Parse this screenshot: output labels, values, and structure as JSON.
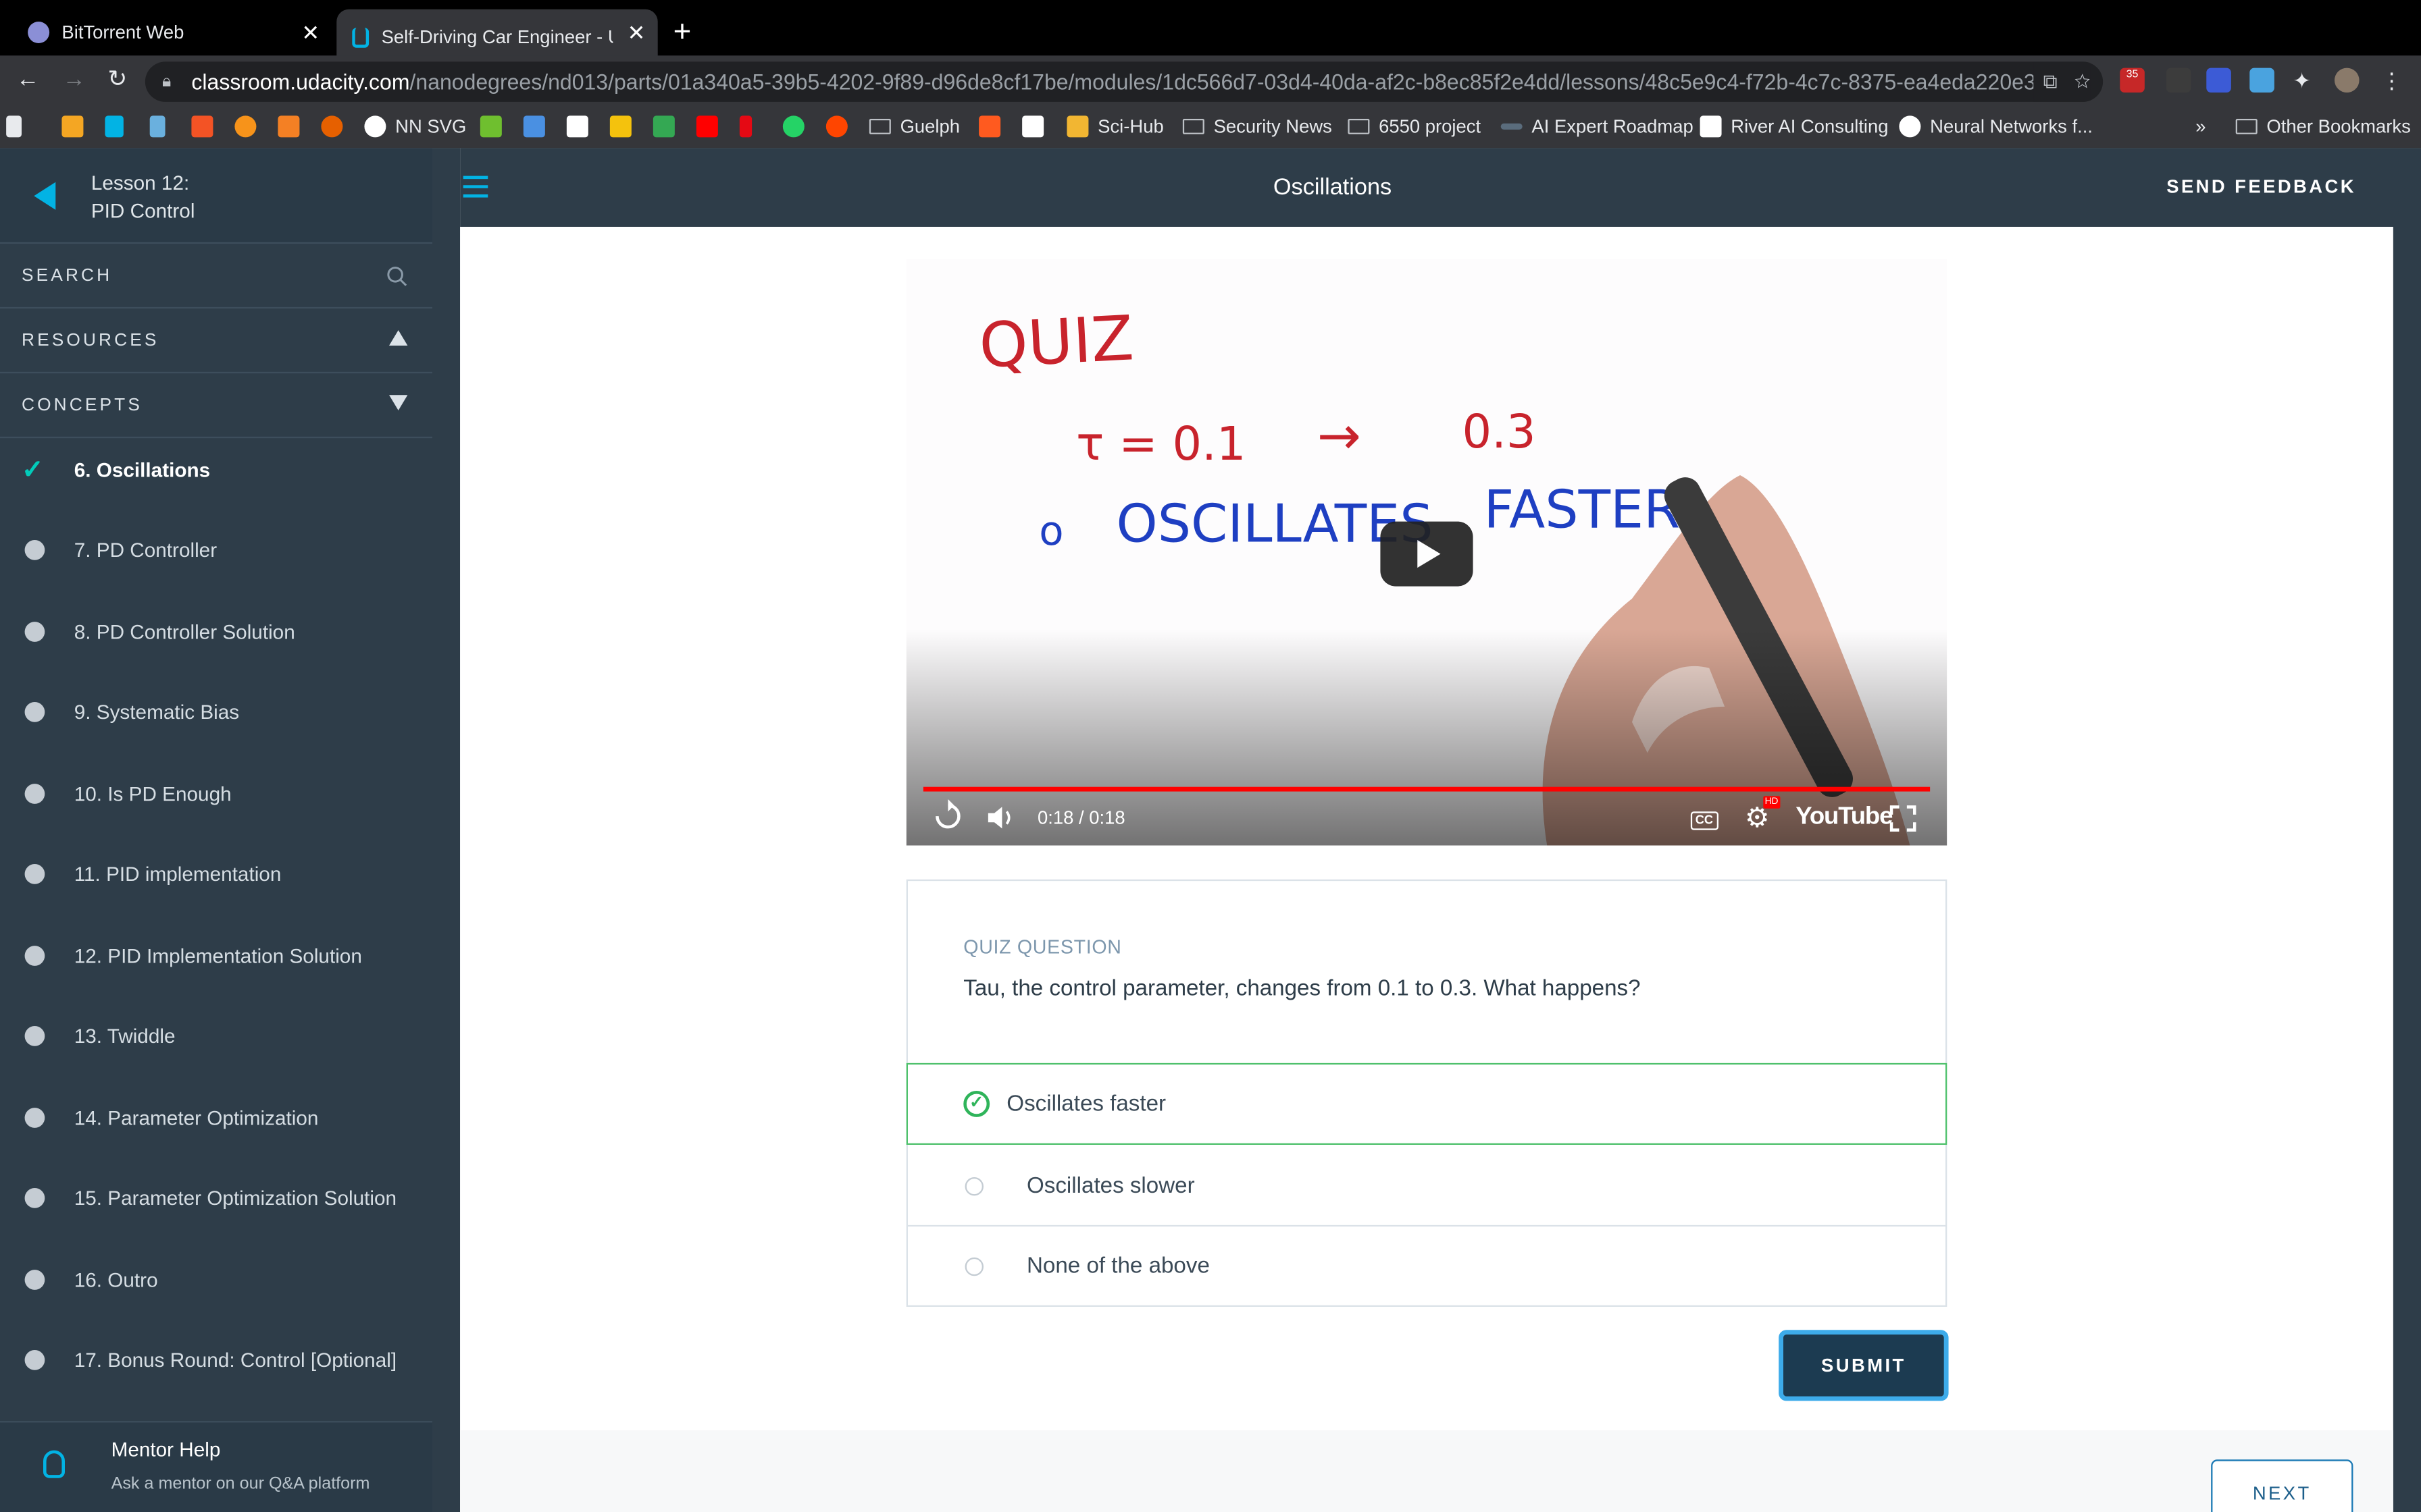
{
  "browser": {
    "tabs": [
      {
        "title": "BitTorrent Web",
        "active": false
      },
      {
        "title": "Self-Driving Car Engineer - Udacity",
        "active": true
      }
    ],
    "url_host": "classroom.udacity.com",
    "url_path": "/nanodegrees/nd013/parts/01a340a5-39b5-4202-9f89-d96de8cf17be/modules/1dc566d7-03d4-40da-af2c-b8ec85f2e4dd/lessons/48c5e9c4-f72b-4c7c-8375-ea4eda220e39/...",
    "ext_badge": "35",
    "bookmarks": [
      "NN SVG",
      "Guelph",
      "Sci-Hub",
      "Security News",
      "6550 project",
      "AI Expert Roadmap",
      "River AI Consulting",
      "Neural Networks f...",
      "Other Bookmarks"
    ],
    "overflow": "»"
  },
  "sidebar": {
    "lesson_line1": "Lesson 12:",
    "lesson_line2": "PID Control",
    "search_label": "SEARCH",
    "resources_label": "RESOURCES",
    "concepts_label": "CONCEPTS",
    "concepts": [
      {
        "label": "6. Oscillations",
        "active": true
      },
      {
        "label": "7. PD Controller"
      },
      {
        "label": "8. PD Controller Solution"
      },
      {
        "label": "9. Systematic Bias"
      },
      {
        "label": "10. Is PD Enough"
      },
      {
        "label": "11. PID implementation"
      },
      {
        "label": "12. PID Implementation Solution"
      },
      {
        "label": "13. Twiddle"
      },
      {
        "label": "14. Parameter Optimization"
      },
      {
        "label": "15. Parameter Optimization Solution"
      },
      {
        "label": "16. Outro"
      },
      {
        "label": "17. Bonus Round: Control [Optional]"
      }
    ],
    "mentor_title": "Mentor Help",
    "mentor_sub": "Ask a mentor on our Q&A platform"
  },
  "header": {
    "title": "Oscillations",
    "feedback": "SEND FEEDBACK"
  },
  "video": {
    "time": "0:18 / 0:18",
    "youtube": "YouTube",
    "cc": "CC",
    "hd": "HD",
    "whiteboard": {
      "quiz": "QUIZ",
      "tau": "τ = 0.1",
      "arrow": "→",
      "tau_to": "0.3",
      "bullet": "o",
      "osc": "OSCILLATES",
      "faster": "FASTER"
    }
  },
  "quiz": {
    "label": "QUIZ QUESTION",
    "question": "Tau, the control parameter, changes from 0.1 to 0.3. What happens?",
    "options": [
      {
        "label": "Oscillates faster",
        "selected": true
      },
      {
        "label": "Oscillates slower",
        "selected": false
      },
      {
        "label": "None of the above",
        "selected": false
      }
    ],
    "submit": "SUBMIT"
  },
  "next_label": "NEXT",
  "colors": {
    "sidebar": "#2e3d49",
    "accent": "#02b3e4",
    "check": "#02ccba",
    "selected": "#4fc16c",
    "submit": "#1c3b51"
  }
}
